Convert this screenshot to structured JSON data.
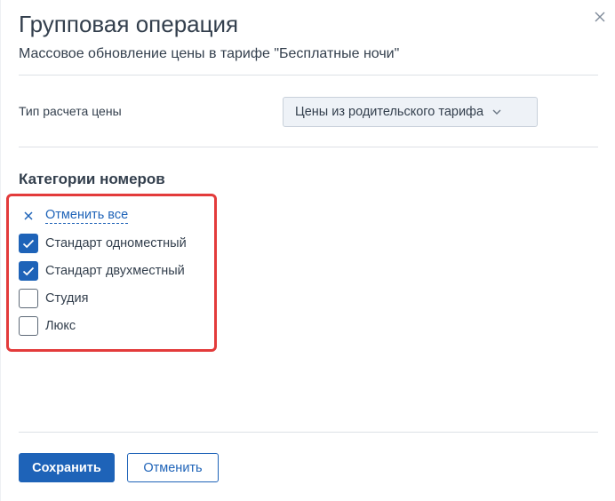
{
  "dialog": {
    "title": "Групповая операция",
    "subtitle": "Массовое обновление цены в тарифе \"Бесплатные ночи\"",
    "close_icon": "close-icon"
  },
  "price_calc": {
    "label": "Тип расчета цены",
    "selected": "Цены из родительского тарифа",
    "options_icon": "chevron-down-icon"
  },
  "room_categories": {
    "title": "Категории номеров",
    "deselect_all": "Отменить все",
    "deselect_icon": "x-icon",
    "items": [
      {
        "label": "Стандарт одноместный",
        "checked": true
      },
      {
        "label": "Стандарт двухместный",
        "checked": true
      },
      {
        "label": "Студия",
        "checked": false
      },
      {
        "label": "Люкс",
        "checked": false
      }
    ]
  },
  "footer": {
    "save_label": "Сохранить",
    "cancel_label": "Отменить"
  },
  "colors": {
    "accent": "#1e63b8",
    "highlight": "#e33b3b",
    "text": "#333f4d",
    "select_bg": "#eef2f7"
  }
}
